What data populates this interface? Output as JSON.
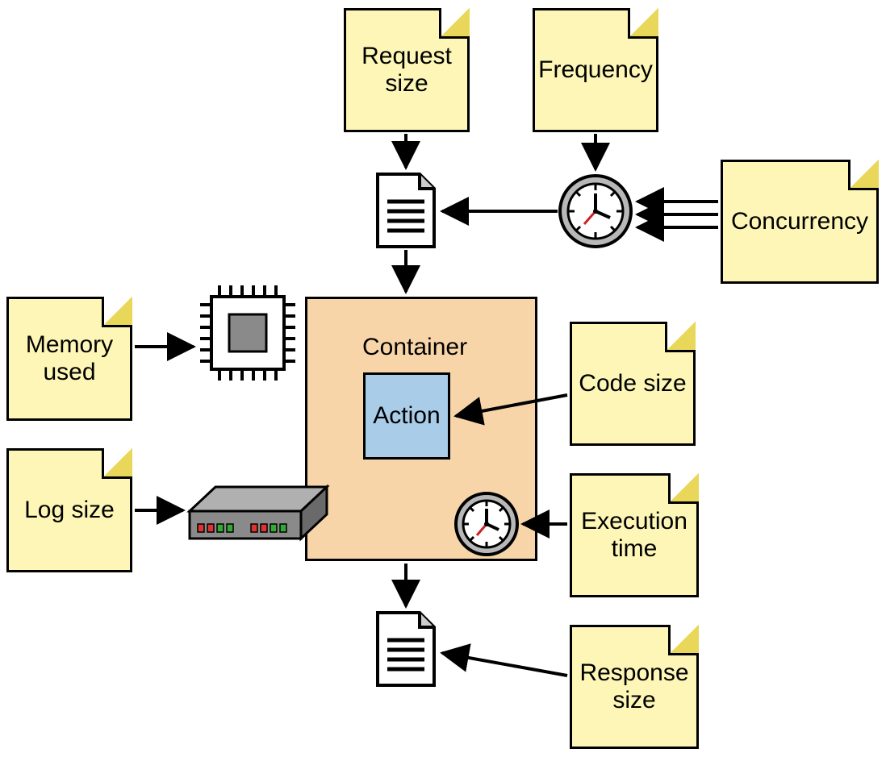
{
  "notes": {
    "request_size": "Request size",
    "frequency": "Frequency",
    "concurrency": "Concurrency",
    "memory_used": "Memory used",
    "code_size": "Code size",
    "log_size": "Log size",
    "execution_time": "Execution time",
    "response_size": "Response size"
  },
  "container": {
    "label": "Container",
    "action": "Action"
  }
}
